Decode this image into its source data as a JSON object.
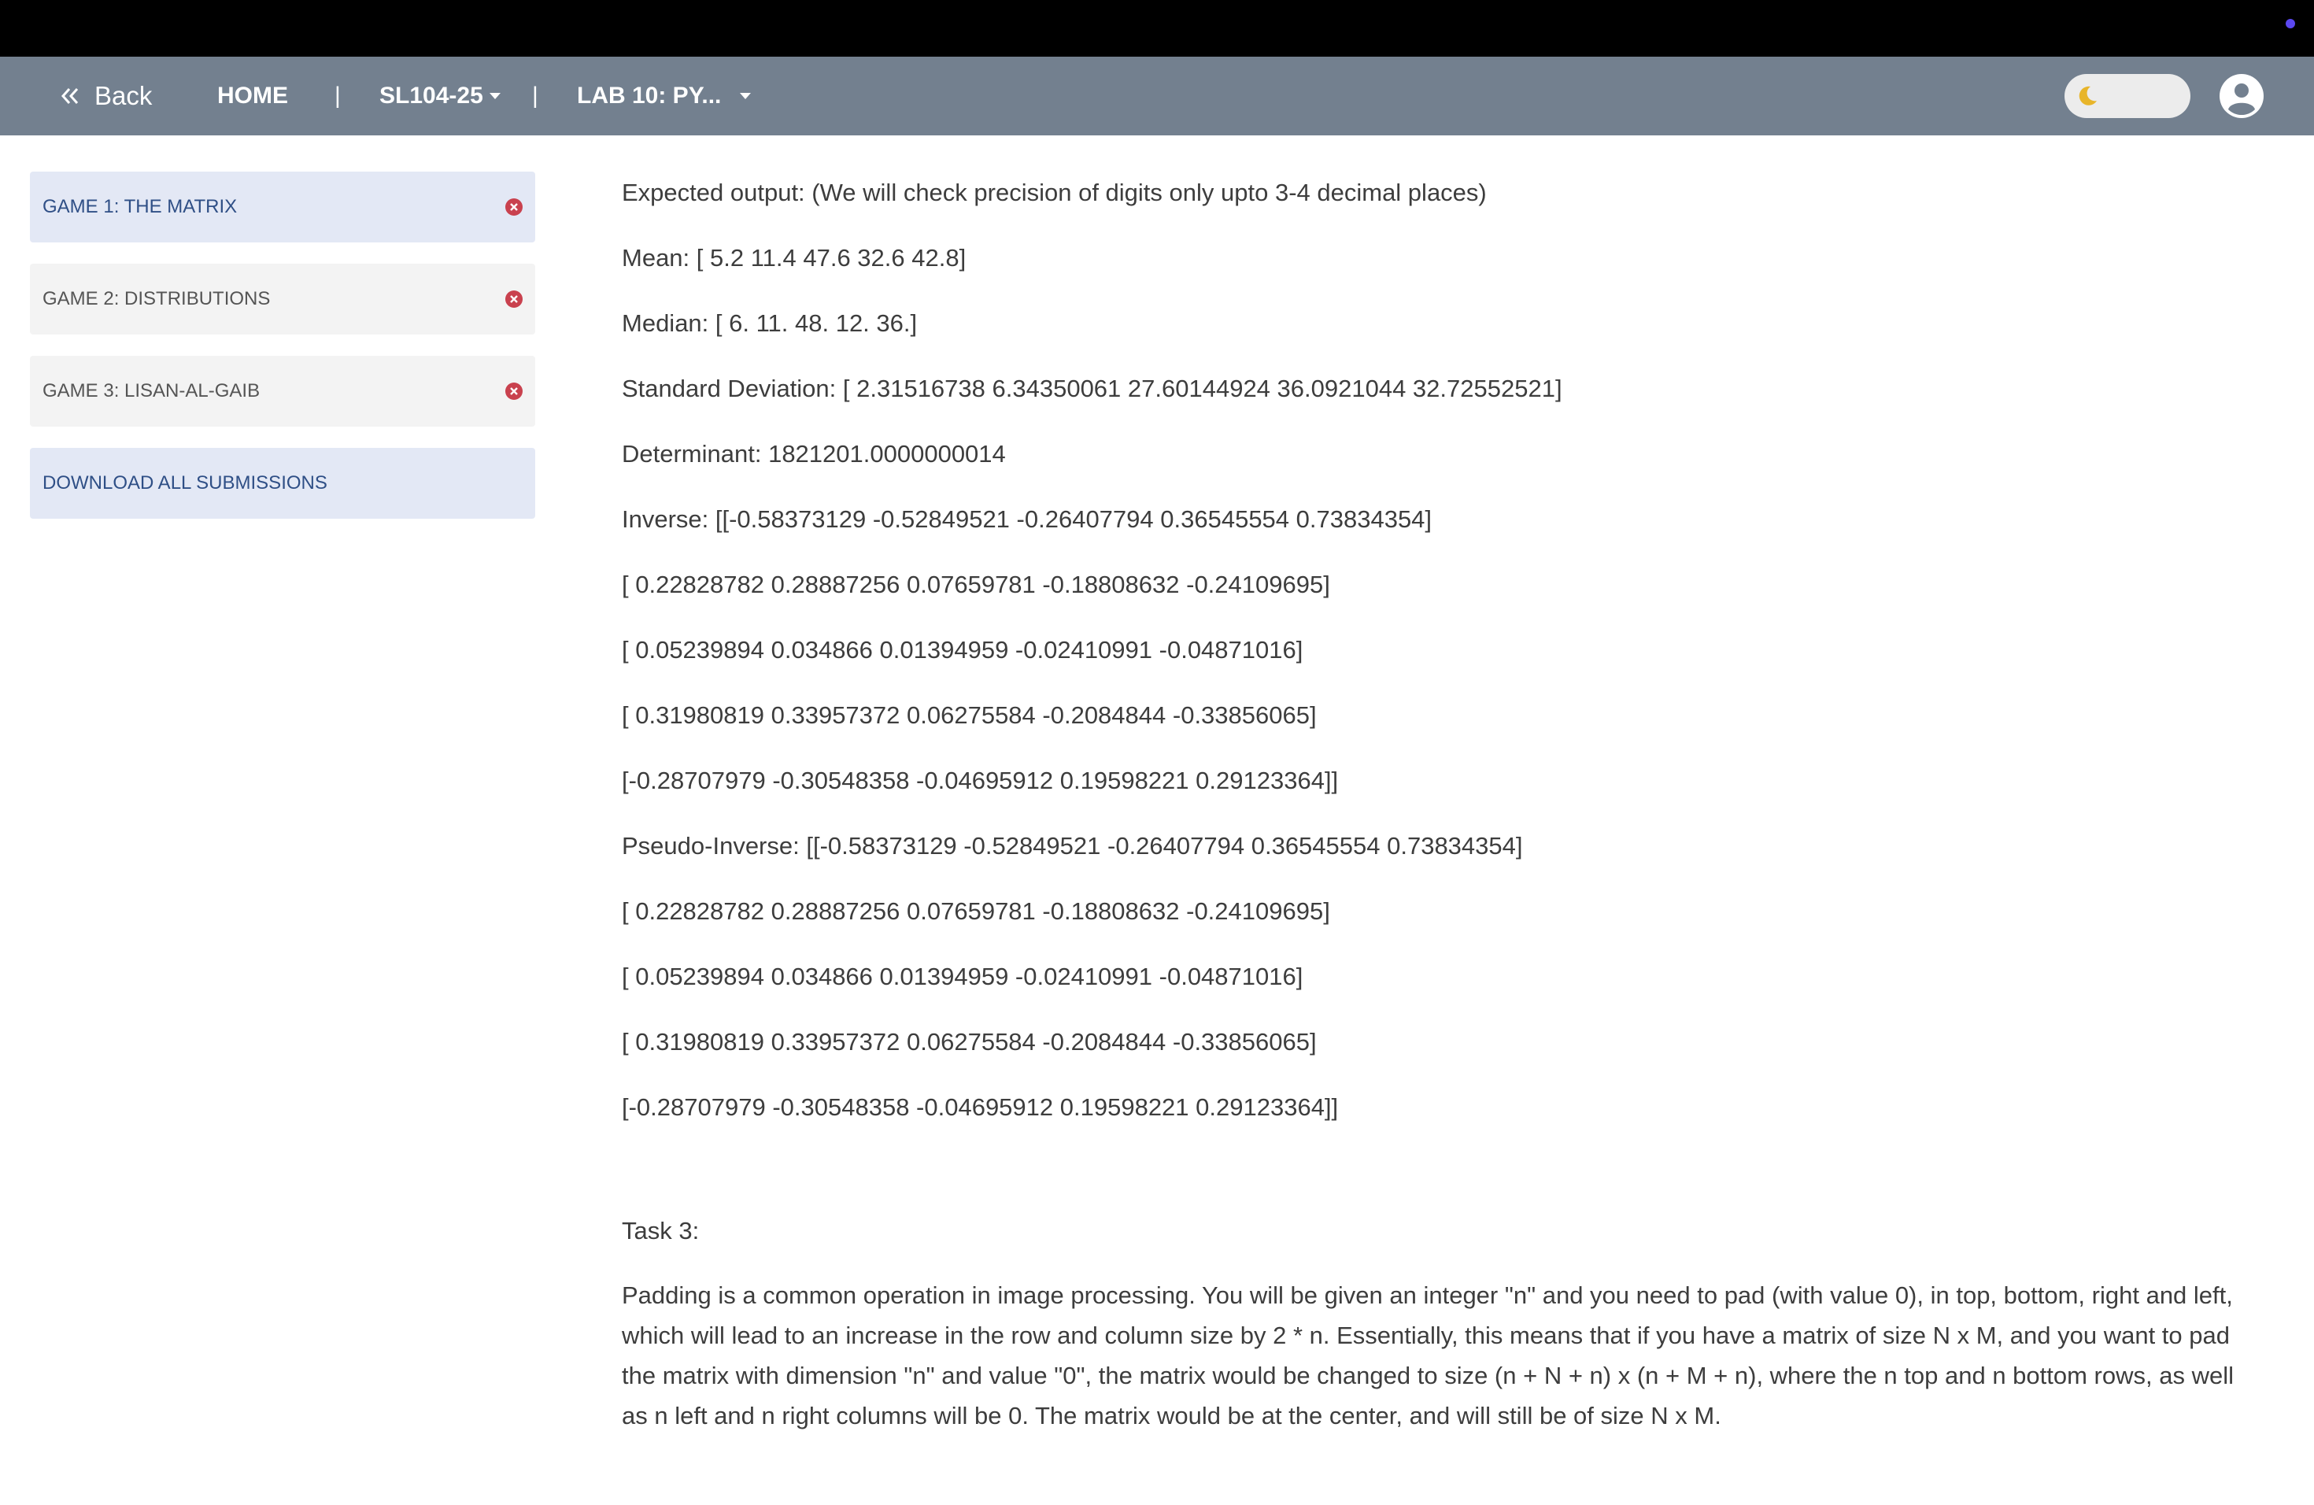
{
  "nav": {
    "back_label": "Back",
    "home_label": "HOME",
    "separator": "|",
    "course_label": "SL104-25",
    "lab_label": "LAB 10: PY..."
  },
  "icons": {
    "back": "chevrons-left-icon",
    "theme": "moon-icon",
    "avatar": "user-circle-icon",
    "remove": "close-circle-icon"
  },
  "colors": {
    "navbar": "#73808f",
    "active_item": "#e3e8f5",
    "remove_icon": "#c9414e",
    "moon": "#e8b52a"
  },
  "sidebar": {
    "items": [
      {
        "label": "GAME 1: THE MATRIX"
      },
      {
        "label": "GAME 2: DISTRIBUTIONS"
      },
      {
        "label": "GAME 3: LISAN-AL-GAIB"
      }
    ],
    "download_label": "DOWNLOAD ALL SUBMISSIONS"
  },
  "content": {
    "lines": [
      "Expected output: (We will check precision of digits only upto 3-4 decimal places)",
      "Mean: [ 5.2 11.4 47.6 32.6 42.8]",
      "Median: [ 6. 11. 48. 12. 36.]",
      "Standard Deviation: [ 2.31516738 6.34350061 27.60144924 36.0921044 32.72552521]",
      "Determinant: 1821201.0000000014",
      "Inverse: [[-0.58373129 -0.52849521 -0.26407794 0.36545554 0.73834354]",
      "[ 0.22828782 0.28887256 0.07659781 -0.18808632 -0.24109695]",
      "[ 0.05239894 0.034866 0.01394959 -0.02410991 -0.04871016]",
      "[ 0.31980819 0.33957372 0.06275584 -0.2084844 -0.33856065]",
      "[-0.28707979 -0.30548358 -0.04695912 0.19598221 0.29123364]]",
      "Pseudo-Inverse: [[-0.58373129 -0.52849521 -0.26407794 0.36545554 0.73834354]",
      "[ 0.22828782 0.28887256 0.07659781 -0.18808632 -0.24109695]",
      "[ 0.05239894 0.034866 0.01394959 -0.02410991 -0.04871016]",
      "[ 0.31980819 0.33957372 0.06275584 -0.2084844 -0.33856065]",
      "[-0.28707979 -0.30548358 -0.04695912 0.19598221 0.29123364]]"
    ],
    "task_title": "Task 3:",
    "task_paragraph": "Padding is a common operation in image processing. You will be given an integer \"n\" and you need to pad (with value 0), in top, bottom, right and left, which will lead to an increase in the row and column size by 2 * n. Essentially, this means that if you have a matrix of size N x M, and you want to pad the matrix with dimension \"n\" and value \"0\", the matrix would be changed to size (n + N + n) x (n + M + n), where the n top and n bottom rows, as well as n left and n right columns will be 0. The matrix would be at the center, and will still be of size N x M."
  }
}
